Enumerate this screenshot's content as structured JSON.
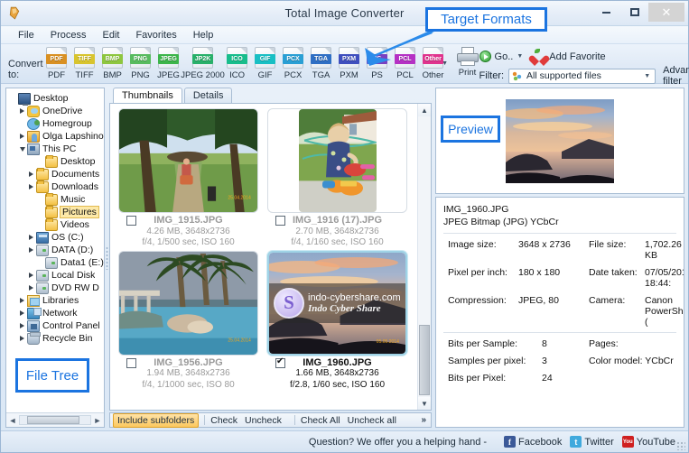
{
  "window": {
    "title": "Total Image Converter",
    "minimize": "–",
    "maximize": "□",
    "close": "✕"
  },
  "menubar": [
    "File",
    "Process",
    "Edit",
    "Favorites",
    "Help"
  ],
  "toolbar": {
    "convert_label": "Convert to:",
    "formats": [
      {
        "name": "PDF",
        "tag": "PDF",
        "color": "#d99022"
      },
      {
        "name": "TIFF",
        "tag": "TIFF",
        "color": "#d8c42e"
      },
      {
        "name": "BMP",
        "tag": "BMP",
        "color": "#8ec63f"
      },
      {
        "name": "PNG",
        "tag": "PNG",
        "color": "#57bb5f"
      },
      {
        "name": "JPEG",
        "tag": "JPEG",
        "color": "#3cb54a"
      },
      {
        "name": "JPEG 2000",
        "tag": "JP2K",
        "color": "#28b06a"
      },
      {
        "name": "ICO",
        "tag": "ICO",
        "color": "#18bd8c"
      },
      {
        "name": "GIF",
        "tag": "GIF",
        "color": "#19bfc4"
      },
      {
        "name": "PCX",
        "tag": "PCX",
        "color": "#2a9fd4"
      },
      {
        "name": "TGA",
        "tag": "TGA",
        "color": "#2f6fc4"
      },
      {
        "name": "PXM",
        "tag": "PXM",
        "color": "#3f4fbe"
      },
      {
        "name": "PS",
        "tag": "PS",
        "color": "#7a3fc0"
      },
      {
        "name": "PCL",
        "tag": "PCL",
        "color": "#b531c4"
      },
      {
        "name": "Other",
        "tag": "Other",
        "color": "#e0338d"
      }
    ],
    "print_label": "Print",
    "go_label": "Go..",
    "add_favorite_label": "Add Favorite",
    "filter_label": "Filter:",
    "filter_value": "All supported files",
    "advanced_filter_label": "Advanced filter"
  },
  "annotations": {
    "target_formats": "Target Formats",
    "preview": "Preview",
    "file_tree": "File Tree",
    "accent_color": "#1b74e0"
  },
  "tree": {
    "items": [
      {
        "label": "Desktop",
        "indent": 0,
        "expander": "none",
        "icon": "monitor-icon",
        "selected": false
      },
      {
        "label": "OneDrive",
        "indent": 1,
        "expander": "collapsed",
        "icon": "cloud-icon",
        "selected": false
      },
      {
        "label": "Homegroup",
        "indent": 1,
        "expander": "none",
        "icon": "homegroup-icon",
        "selected": false
      },
      {
        "label": "Olga Lapshinov",
        "indent": 1,
        "expander": "collapsed",
        "icon": "user-icon",
        "selected": false
      },
      {
        "label": "This PC",
        "indent": 1,
        "expander": "expanded",
        "icon": "pc-icon",
        "selected": false
      },
      {
        "label": "Desktop",
        "indent": 3,
        "expander": "none",
        "icon": "folder-desktop-icon",
        "selected": false
      },
      {
        "label": "Documents",
        "indent": 2,
        "expander": "collapsed",
        "icon": "folder-docs-icon",
        "selected": false
      },
      {
        "label": "Downloads",
        "indent": 2,
        "expander": "collapsed",
        "icon": "folder-downloads-icon",
        "selected": false
      },
      {
        "label": "Music",
        "indent": 3,
        "expander": "none",
        "icon": "folder-music-icon",
        "selected": false
      },
      {
        "label": "Pictures",
        "indent": 3,
        "expander": "none",
        "icon": "folder-pictures-icon",
        "selected": true
      },
      {
        "label": "Videos",
        "indent": 3,
        "expander": "none",
        "icon": "folder-videos-icon",
        "selected": false
      },
      {
        "label": "OS (C:)",
        "indent": 2,
        "expander": "collapsed",
        "icon": "harddisk-icon",
        "selected": false
      },
      {
        "label": "DATA (D:)",
        "indent": 2,
        "expander": "collapsed",
        "icon": "drive-icon",
        "selected": false
      },
      {
        "label": "Data1 (E:)",
        "indent": 3,
        "expander": "none",
        "icon": "drive-icon",
        "selected": false
      },
      {
        "label": "Local Disk",
        "indent": 2,
        "expander": "collapsed",
        "icon": "drive-icon",
        "selected": false
      },
      {
        "label": "DVD RW D",
        "indent": 2,
        "expander": "collapsed",
        "icon": "dvd-icon",
        "selected": false
      },
      {
        "label": "Libraries",
        "indent": 1,
        "expander": "collapsed",
        "icon": "libraries-icon",
        "selected": false
      },
      {
        "label": "Network",
        "indent": 1,
        "expander": "collapsed",
        "icon": "network-icon",
        "selected": false
      },
      {
        "label": "Control Panel",
        "indent": 1,
        "expander": "collapsed",
        "icon": "control-panel-icon",
        "selected": false
      },
      {
        "label": "Recycle Bin",
        "indent": 1,
        "expander": "collapsed",
        "icon": "recycle-bin-icon",
        "selected": false
      }
    ]
  },
  "tabs": [
    {
      "label": "Thumbnails",
      "active": true
    },
    {
      "label": "Details",
      "active": false
    }
  ],
  "thumbnails": [
    {
      "name": "IMG_1915.JPG",
      "size_line": "4.26 MB, 3648x2736",
      "exif_line": "f/4, 1/500 sec, ISO 160",
      "checked": false,
      "selected": false,
      "orientation": "landscape",
      "scene": "forest-path",
      "date_stamp": "25.04.2014"
    },
    {
      "name": "IMG_1916 (17).JPG",
      "size_line": "2.70 MB, 3648x2736",
      "exif_line": "f/4, 1/160 sec, ISO 160",
      "checked": false,
      "selected": false,
      "orientation": "portrait",
      "scene": "child-garden",
      "date_stamp": ""
    },
    {
      "name": "IMG_1956.JPG",
      "size_line": "1.94 MB, 3648x2736",
      "exif_line": "f/4, 1/1000 sec, ISO 80",
      "checked": false,
      "selected": false,
      "orientation": "landscape",
      "scene": "pool-palms",
      "date_stamp": "25.04.2014"
    },
    {
      "name": "IMG_1960.JPG",
      "size_line": "1.66 MB, 3648x2736",
      "exif_line": "f/2.8, 1/60 sec, ISO 160",
      "checked": true,
      "selected": true,
      "orientation": "landscape",
      "scene": "sunset-bay",
      "date_stamp": "05.05.2014"
    }
  ],
  "watermark": {
    "line1": "indo-cybershare.com",
    "line2": "Indo Cyber Share",
    "logo_letter": "S"
  },
  "thumb_toolbar": {
    "include_subfolders": "Include subfolders",
    "check": "Check",
    "uncheck": "Uncheck",
    "check_all": "Check All",
    "uncheck_all": "Uncheck all",
    "more": "»"
  },
  "properties": {
    "file_name": "IMG_1960.JPG",
    "format_line": "JPEG Bitmap (JPG) YCbCr",
    "rows_top": [
      {
        "k1": "Image size:",
        "v1": "3648 x 2736",
        "k2": "File size:",
        "v2": "1,702.26 KB"
      },
      {
        "k1": "Pixel per inch:",
        "v1": "180 x 180",
        "k2": "Date taken:",
        "v2": "07/05/2014 18:44:"
      },
      {
        "k1": "Compression:",
        "v1": "JPEG, 80",
        "k2": "Camera:",
        "v2": "Canon PowerShot ("
      }
    ],
    "rows_bottom": [
      {
        "k1": "Bits per Sample:",
        "v1": "8",
        "k2": "Pages:",
        "v2": ""
      },
      {
        "k1": "Samples per pixel:",
        "v1": "3",
        "k2": "Color model:",
        "v2": "YCbCr"
      },
      {
        "k1": "Bits per Pixel:",
        "v1": "24",
        "k2": "",
        "v2": ""
      }
    ]
  },
  "statusbar": {
    "message": "Question? We offer you a helping hand -",
    "links": [
      {
        "label": "Facebook",
        "icon": "facebook-icon",
        "glyph": "f"
      },
      {
        "label": "Twitter",
        "icon": "twitter-icon",
        "glyph": "t"
      },
      {
        "label": "YouTube",
        "icon": "youtube-icon",
        "glyph": "You"
      }
    ]
  }
}
